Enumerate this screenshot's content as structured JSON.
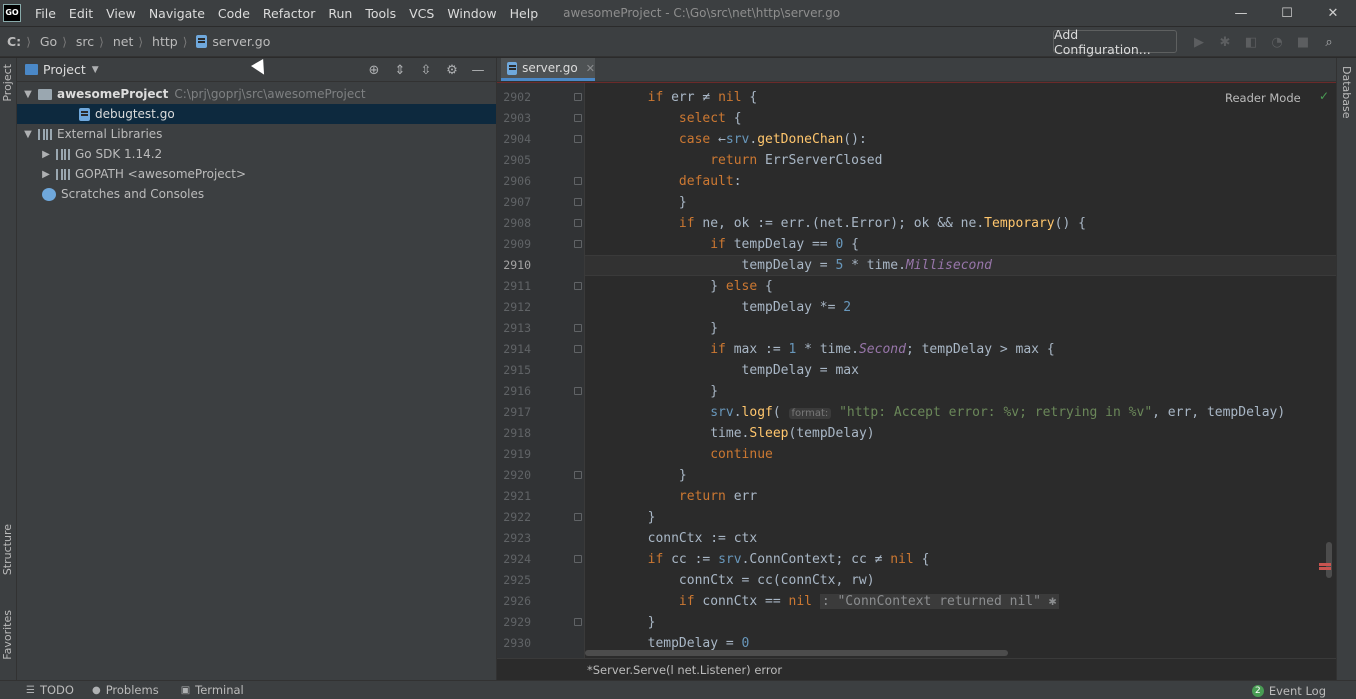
{
  "window": {
    "logo_text": "GO",
    "title": "awesomeProject - C:\\Go\\src\\net\\http\\server.go",
    "controls": {
      "minimize": "—",
      "maximize": "☐",
      "close": "✕"
    }
  },
  "menu": [
    "File",
    "Edit",
    "View",
    "Navigate",
    "Code",
    "Refactor",
    "Run",
    "Tools",
    "VCS",
    "Window",
    "Help"
  ],
  "navbar": {
    "crumbs": [
      "C:",
      "Go",
      "src",
      "net",
      "http",
      "server.go"
    ],
    "add_configuration": "Add Configuration..."
  },
  "sidebar_left": {
    "project_tab": "Project",
    "structure_tab": "Structure",
    "favorites_tab": "Favorites"
  },
  "sidebar_right": {
    "database_tab": "Database"
  },
  "project_panel": {
    "title": "Project",
    "tree": [
      {
        "label": "awesomeProject",
        "extra": "C:\\prj\\goprj\\src\\awesomeProject"
      },
      {
        "label": "debugtest.go"
      },
      {
        "label": "External Libraries"
      },
      {
        "label": "Go SDK 1.14.2"
      },
      {
        "label": "GOPATH <awesomeProject>"
      },
      {
        "label": "Scratches and Consoles"
      }
    ]
  },
  "editor": {
    "tab": "server.go",
    "reader_mode": "Reader Mode",
    "line_numbers": [
      "2902",
      "2903",
      "2904",
      "2905",
      "2906",
      "2907",
      "2908",
      "2909",
      "2910",
      "2911",
      "2912",
      "2913",
      "2914",
      "2915",
      "2916",
      "2917",
      "2918",
      "2919",
      "2920",
      "2921",
      "2922",
      "2923",
      "2924",
      "2925",
      "2926",
      "2929",
      "2930"
    ],
    "current_line": "2910",
    "param_hint": "format:",
    "breadcrumb": "*Server.Serve(l net.Listener) error"
  },
  "bottom_bar": {
    "todo": "TODO",
    "problems": "Problems",
    "terminal": "Terminal",
    "event_log": "Event Log",
    "event_count": "2"
  }
}
